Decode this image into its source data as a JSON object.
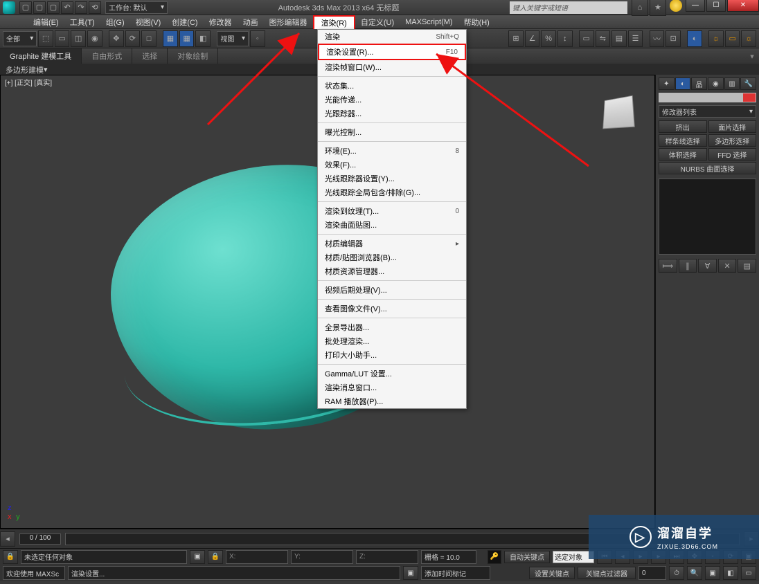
{
  "titlebar": {
    "workspace_label": "工作台: 默认",
    "app_title": "Autodesk 3ds Max 2013 x64   无标题",
    "search_placeholder": "键入关键字或短语"
  },
  "menubar": {
    "items": [
      "编辑(E)",
      "工具(T)",
      "组(G)",
      "视图(V)",
      "创建(C)",
      "修改器",
      "动画",
      "图形编辑器",
      "渲染(R)",
      "自定义(U)",
      "MAXScript(M)",
      "帮助(H)"
    ],
    "open_index": 8
  },
  "toolbar2": {
    "sel1": "全部",
    "view_label": "视图"
  },
  "ribbon": {
    "tabs": [
      "Graphite 建模工具",
      "自由形式",
      "选择",
      "对象绘制"
    ],
    "sub": "多边形建模"
  },
  "viewport": {
    "label": "[+] [正交] [真实]"
  },
  "dropdown": {
    "items": [
      {
        "label": "渲染",
        "shortcut": "Shift+Q",
        "type": "row"
      },
      {
        "label": "渲染设置(R)...",
        "shortcut": "F10",
        "type": "hilite"
      },
      {
        "label": "渲染帧窗口(W)...",
        "shortcut": "",
        "type": "row"
      },
      {
        "type": "sep"
      },
      {
        "label": "状态集...",
        "type": "row"
      },
      {
        "label": "光能传递...",
        "type": "row"
      },
      {
        "label": "光跟踪器...",
        "type": "row"
      },
      {
        "type": "sep"
      },
      {
        "label": "曝光控制...",
        "type": "row"
      },
      {
        "type": "sep"
      },
      {
        "label": "环境(E)...",
        "shortcut": "8",
        "type": "row"
      },
      {
        "label": "效果(F)...",
        "type": "row"
      },
      {
        "label": "光线跟踪器设置(Y)...",
        "type": "row"
      },
      {
        "label": "光线跟踪全局包含/排除(G)...",
        "type": "row"
      },
      {
        "type": "sep"
      },
      {
        "label": "渲染到纹理(T)...",
        "shortcut": "0",
        "type": "row"
      },
      {
        "label": "渲染曲面贴图...",
        "type": "row"
      },
      {
        "type": "sep"
      },
      {
        "label": "材质编辑器",
        "shortcut": "▸",
        "type": "row"
      },
      {
        "label": "材质/贴图浏览器(B)...",
        "type": "row"
      },
      {
        "label": "材质资源管理器...",
        "type": "row"
      },
      {
        "type": "sep"
      },
      {
        "label": "视频后期处理(V)...",
        "type": "row"
      },
      {
        "type": "sep"
      },
      {
        "label": "查看图像文件(V)...",
        "type": "row"
      },
      {
        "type": "sep"
      },
      {
        "label": "全景导出器...",
        "type": "row"
      },
      {
        "label": "批处理渲染...",
        "type": "row"
      },
      {
        "label": "打印大小助手...",
        "type": "row"
      },
      {
        "type": "sep"
      },
      {
        "label": "Gamma/LUT 设置...",
        "type": "row"
      },
      {
        "label": "渲染消息窗口...",
        "type": "row"
      },
      {
        "label": "RAM 播放器(P)...",
        "type": "row"
      }
    ]
  },
  "cmdpanel": {
    "mod_list": "修改器列表",
    "buttons": [
      "挤出",
      "面片选择",
      "样条线选择",
      "多边形选择",
      "体积选择",
      "FFD 选择"
    ],
    "nurbs": "NURBS 曲面选择"
  },
  "timeline": {
    "frame": "0 / 100"
  },
  "status": {
    "no_sel": "未选定任何对象",
    "x": "X:",
    "y": "Y:",
    "z": "Z:",
    "grid": "栅格 = 10.0",
    "autokey": "自动关键点",
    "selobj": "选定对象",
    "welcome": "欢迎使用 MAXSc",
    "render_settings": "渲染设置...",
    "add_time": "添加时间标记",
    "setkey": "设置关键点",
    "keyfilter": "关键点过滤器"
  },
  "watermark": {
    "main": "溜溜自学",
    "sub": "ZIXUE.3D66.COM"
  }
}
